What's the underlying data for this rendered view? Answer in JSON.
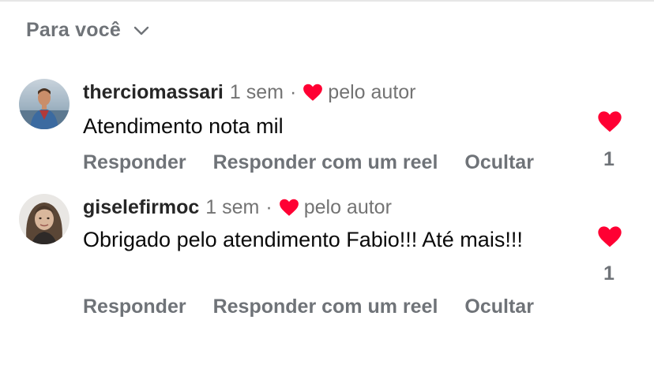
{
  "sort": {
    "label": "Para você",
    "icon": "chevron-down-icon"
  },
  "colors": {
    "heart": "#ff0033",
    "muted": "#6f7378",
    "text": "#0a0a0a"
  },
  "comments": [
    {
      "username": "therciomassari",
      "time": "1 sem",
      "separator": "·",
      "liked_by_author_label": "pelo autor",
      "text": "Atendimento nota mil",
      "actions": {
        "reply": "Responder",
        "reply_reel": "Responder com um reel",
        "hide": "Ocultar"
      },
      "like_count": "1",
      "liked": true
    },
    {
      "username": "giselefirmoc",
      "time": "1 sem",
      "separator": "·",
      "liked_by_author_label": "pelo autor",
      "text": "Obrigado pelo atendimento Fabio!!! Até mais!!!",
      "actions": {
        "reply": "Responder",
        "reply_reel": "Responder com um reel",
        "hide": "Ocultar"
      },
      "like_count": "1",
      "liked": true
    }
  ]
}
